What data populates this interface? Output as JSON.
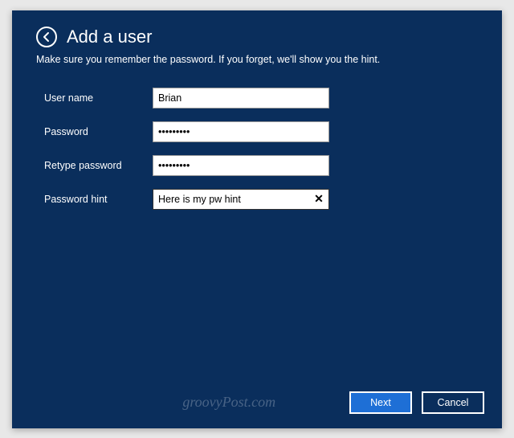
{
  "header": {
    "title": "Add a user",
    "subtitle": "Make sure you remember the password. If you forget, we'll show you the hint."
  },
  "form": {
    "username_label": "User name",
    "username_value": "Brian",
    "password_label": "Password",
    "password_value": "•••••••••",
    "retype_label": "Retype password",
    "retype_value": "•••••••••",
    "hint_label": "Password hint",
    "hint_value": "Here is my pw hint",
    "clear_symbol": "✕"
  },
  "footer": {
    "next_label": "Next",
    "cancel_label": "Cancel"
  },
  "watermark": "groovyPost.com"
}
